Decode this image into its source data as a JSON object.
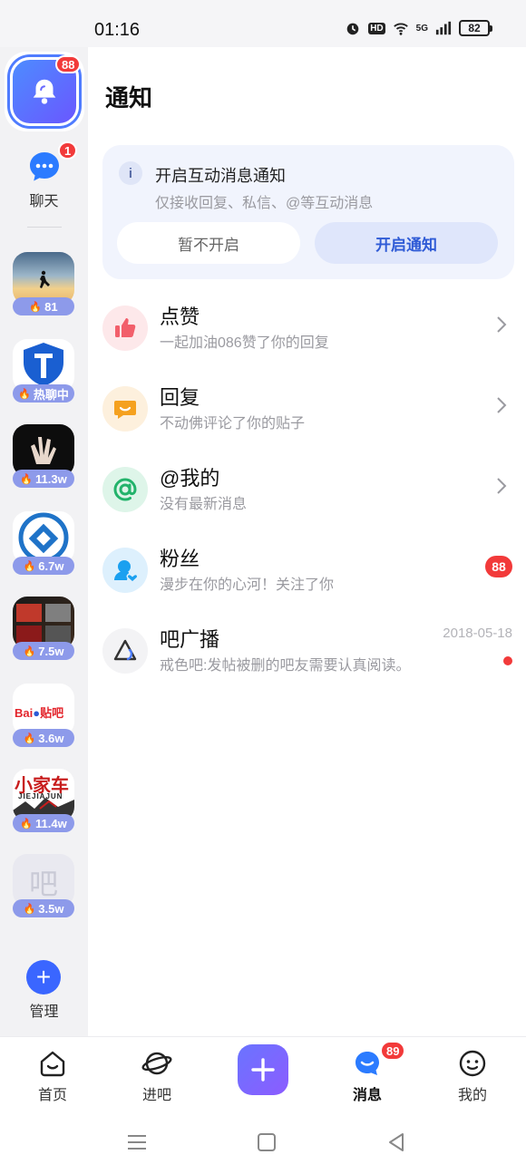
{
  "status_bar": {
    "time": "01:16",
    "battery": "82",
    "network": "5G",
    "hd": "HD"
  },
  "rail": {
    "bell_badge": "88",
    "chat": {
      "label": "聊天",
      "badge": "1"
    },
    "forums": [
      {
        "heat": "81",
        "theme": "sunset-runner"
      },
      {
        "heat": "热聊中",
        "theme": "blue-shield"
      },
      {
        "heat": "11.3w",
        "theme": "hand-dark"
      },
      {
        "heat": "6.7w",
        "theme": "blue-logo"
      },
      {
        "heat": "7.5w",
        "theme": "game-poster"
      },
      {
        "heat": "3.6w",
        "theme": "baidu-tieba"
      },
      {
        "heat": "11.4w",
        "theme": "jiejiajun"
      },
      {
        "heat": "3.5w",
        "theme": "ba-placeholder"
      }
    ],
    "forum_baidu_text": "Bai",
    "forum_tieba_text": "贴吧",
    "forum_jiejiajun_title": "小家车",
    "forum_jiejiajun_sub": "JIEJIAJUN",
    "forum_ba_text": "吧",
    "manage_label": "管理"
  },
  "page": {
    "title": "通知"
  },
  "notice": {
    "title": "开启互动消息通知",
    "subtitle": "仅接收回复、私信、@等互动消息",
    "later_label": "暂不开启",
    "enable_label": "开启通知"
  },
  "messages": [
    {
      "title": "点赞",
      "subtitle": "一起加油086赞了你的回复",
      "icon": "thumbs-up-icon",
      "color": "#f25f6b"
    },
    {
      "title": "回复",
      "subtitle": "不动佛评论了你的贴子",
      "icon": "reply-bubble-icon",
      "color": "#f5a11f"
    },
    {
      "title": "@我的",
      "subtitle": "没有最新消息",
      "icon": "at-sign-icon",
      "color": "#23b36b"
    },
    {
      "title": "粉丝",
      "subtitle": "漫步在你的心河！关注了你",
      "icon": "fans-heart-icon",
      "color": "#1aa0f0",
      "badge": "88"
    },
    {
      "title": "吧广播",
      "subtitle": "戒色吧:发帖被删的吧友需要认真阅读。",
      "icon": "broadcast-icon",
      "date": "2018-05-18"
    }
  ],
  "tabs": [
    {
      "label": "首页",
      "icon": "home-icon"
    },
    {
      "label": "进吧",
      "icon": "planet-icon"
    },
    {
      "label": "消息",
      "icon": "message-icon",
      "badge": "89",
      "active": true
    },
    {
      "label": "我的",
      "icon": "profile-icon"
    }
  ],
  "fab_icon": "plus-icon",
  "colors": {
    "accent": "#3a66ff",
    "badge": "#f23a3a",
    "heat_pill": "#8d9aea"
  }
}
